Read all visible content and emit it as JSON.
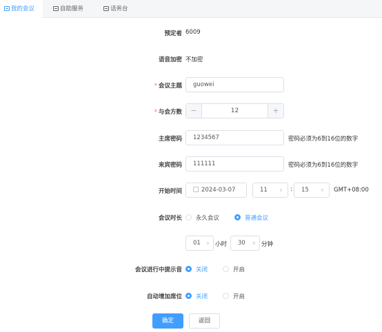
{
  "tabs": [
    {
      "label": "我的会议"
    },
    {
      "label": "自助服务"
    },
    {
      "label": "话务台"
    }
  ],
  "form": {
    "booker": {
      "label": "预定者",
      "value": "6009"
    },
    "encryption": {
      "label": "语音加密",
      "value": "不加密"
    },
    "subject": {
      "label": "会议主题",
      "value": "guowei"
    },
    "participants": {
      "label": "与会方数",
      "value": "12",
      "minus": "−",
      "plus": "+"
    },
    "host_password": {
      "label": "主席密码",
      "value": "1234567",
      "hint": "密码必须为6到16位的数字"
    },
    "guest_password": {
      "label": "来宾密码",
      "value": "111111",
      "hint": "密码必须为6到16位的数字"
    },
    "start_time": {
      "label": "开始时间",
      "date": "2024-03-07",
      "hour": "11",
      "minute": "15",
      "separator": ":",
      "timezone": "GMT+08:00"
    },
    "duration": {
      "label": "会议时长",
      "option_permanent": "永久会议",
      "option_normal": "普通会议",
      "selected": "普通会议",
      "hours": "01",
      "hours_unit": "小时",
      "minutes": "30",
      "minutes_unit": "分钟"
    },
    "prompt_tone": {
      "label": "会议进行中提示音",
      "option_off": "关闭",
      "option_on": "开启",
      "selected": "关闭"
    },
    "auto_seats": {
      "label": "自动增加席位",
      "option_off": "关闭",
      "option_on": "开启",
      "selected": "关闭"
    }
  },
  "actions": {
    "confirm": "确定",
    "back": "返回"
  },
  "colors": {
    "accent": "#409eff",
    "required": "#f56c6c",
    "border": "#dcdfe6"
  },
  "icons": {
    "tab": "document-icon",
    "date": "calendar-icon",
    "select": "chevron-down-icon"
  }
}
